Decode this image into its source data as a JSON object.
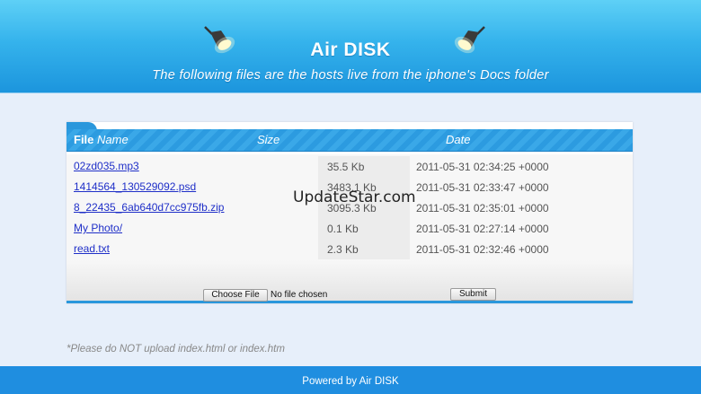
{
  "header": {
    "title": "Air DISK",
    "subtitle": "The following files are the hosts live from the iphone's Docs folder",
    "colors": {
      "top": "#5ed0f6",
      "bottom": "#1c95dd"
    }
  },
  "table": {
    "headers": {
      "name_bold": "File",
      "name": "Name",
      "size": "Size",
      "date": "Date"
    },
    "rows": [
      {
        "name": "02zd035.mp3",
        "size": "35.5 Kb",
        "date": "2011-05-31 02:34:25 +0000"
      },
      {
        "name": "1414564_130529092.psd",
        "size": "3483.1 Kb",
        "date": "2011-05-31 02:33:47 +0000"
      },
      {
        "name": "8_22435_6ab640d7cc975fb.zip",
        "size": "3095.3 Kb",
        "date": "2011-05-31 02:35:01 +0000"
      },
      {
        "name": "My Photo/",
        "size": "0.1 Kb",
        "date": "2011-05-31 02:27:14 +0000"
      },
      {
        "name": "read.txt",
        "size": "2.3 Kb",
        "date": "2011-05-31 02:32:46 +0000"
      }
    ]
  },
  "upload": {
    "choose_label": "Choose File",
    "no_file": "No file chosen",
    "submit_label": "Submit"
  },
  "watermark": "UpdateStar.com",
  "note": "*Please do NOT upload index.html or index.htm",
  "footer": "Powered by Air DISK",
  "icons": {
    "lamp_left": "lamp-icon",
    "lamp_right": "lamp-icon"
  }
}
